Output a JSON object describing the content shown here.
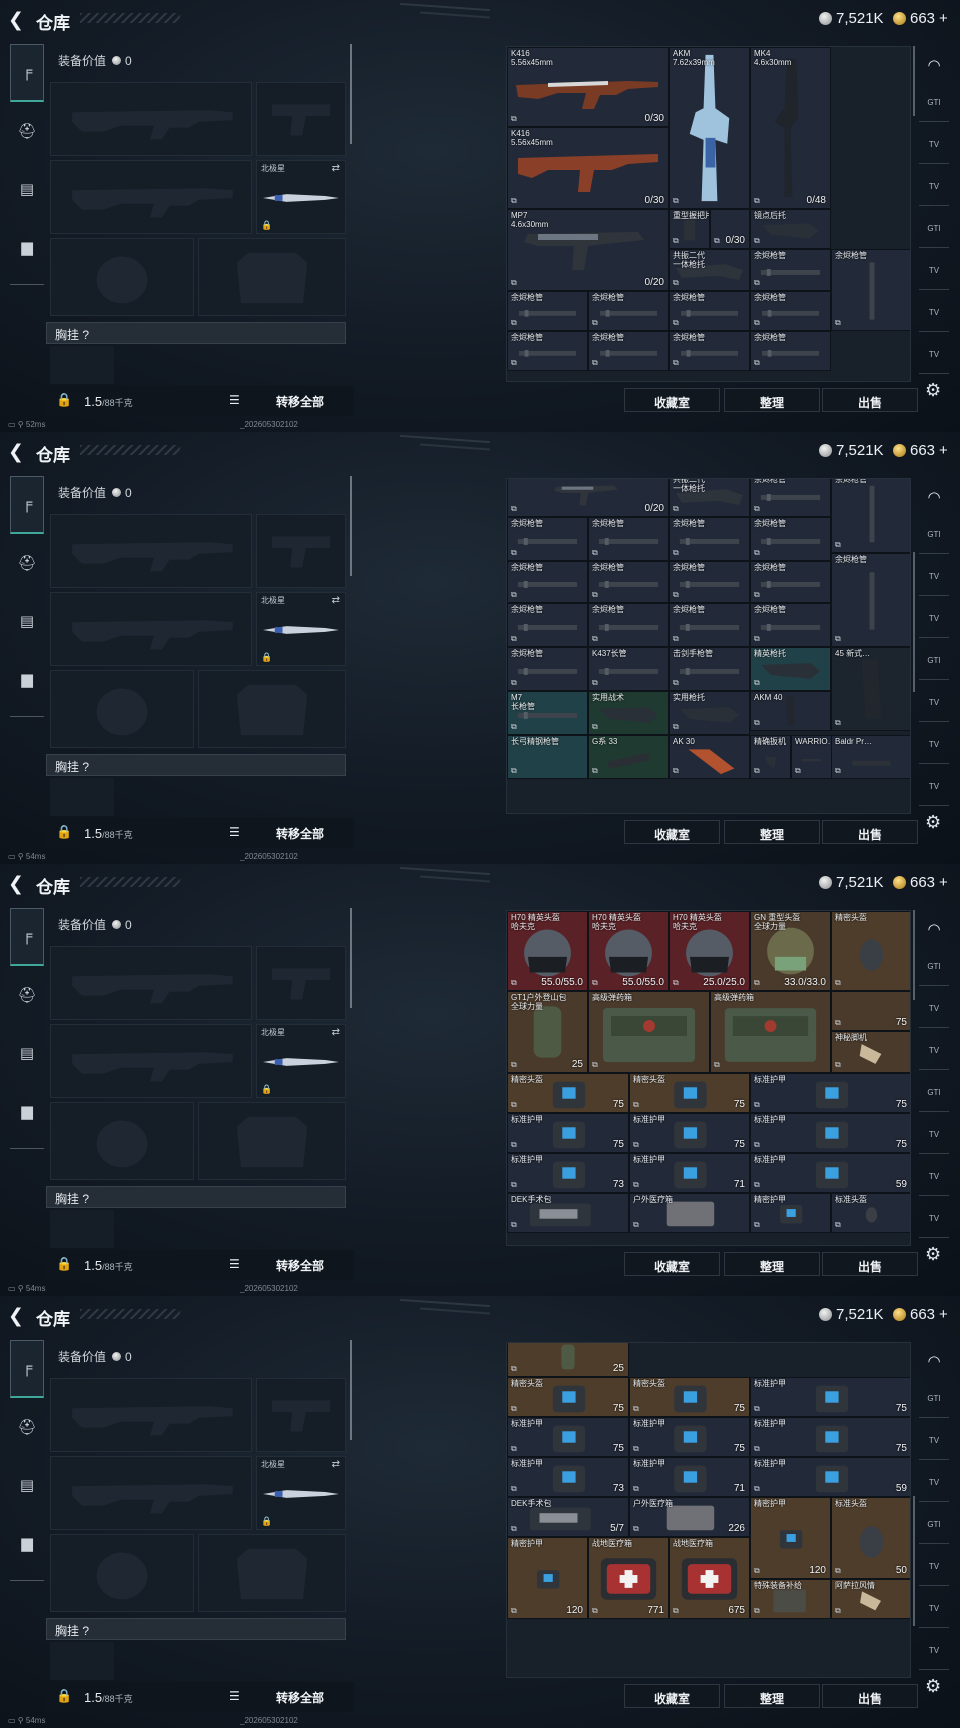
{
  "header": {
    "back_icon": "chevron-left-icon",
    "title": "仓库",
    "silver": "7,521K",
    "gold": "663",
    "gold_plus": "+"
  },
  "left_nav": {
    "icons": [
      "gun-icon",
      "helmet-icon",
      "vest-icon",
      "briefcase-icon"
    ]
  },
  "equipment": {
    "value_label": "装备价值",
    "value": "0",
    "melee_label": "北极星",
    "chest_label": "胸挂 ?",
    "weight": "1.5",
    "weight_max": "/88千克",
    "transfer_all": "转移全部"
  },
  "buttons": {
    "favorites": "收藏室",
    "sort": "整理",
    "sell": "出售"
  },
  "status": {
    "panel1": "52ms",
    "panel2": "54ms",
    "panel3": "54ms",
    "panel4": "54ms",
    "build": "_202605302102"
  },
  "rail": {
    "items": [
      "GTI",
      "TV",
      "TV",
      "GTI",
      "TV",
      "TV",
      "TV",
      "TV"
    ]
  },
  "colors": {
    "accent_teal": "#3fa89a",
    "item_red": "#5a2126",
    "item_brown": "#4a3a2b",
    "item_std": "#222938"
  },
  "panels": [
    {
      "cells": [
        {
          "name": "K416\n5.56x45mm",
          "value": "0/30"
        },
        {
          "name": "AKM\n7.62x39mm",
          "value": ""
        },
        {
          "name": "MK4\n4.6x30mm",
          "value": "0/48"
        },
        {
          "name": "K416\n5.56x45mm",
          "value": "0/30"
        },
        {
          "name": "MP7\n4.6x30mm",
          "value": "0/20"
        },
        {
          "name": "重型握把片",
          "value": ""
        },
        {
          "name": "",
          "value": "0/30"
        },
        {
          "name": "镜点后托",
          "value": ""
        },
        {
          "name": "共振二代\n一体枪托",
          "value": ""
        },
        {
          "name": "余烬枪管",
          "value": ""
        },
        {
          "name": "余烬枪管",
          "value": ""
        },
        {
          "name": "余烬枪管",
          "value": ""
        },
        {
          "name": "余烬枪管",
          "value": ""
        },
        {
          "name": "余烬枪管",
          "value": ""
        },
        {
          "name": "余烬枪管",
          "value": ""
        },
        {
          "name": "余烬枪管",
          "value": ""
        },
        {
          "name": "余烬枪管",
          "value": ""
        },
        {
          "name": "余烬枪管",
          "value": ""
        },
        {
          "name": "余烬枪管",
          "value": ""
        }
      ]
    },
    {
      "cells": [
        {
          "name": "",
          "value": "0/20"
        },
        {
          "name": "共振二代\n一体枪托",
          "value": ""
        },
        {
          "name": "余烬枪管",
          "value": ""
        },
        {
          "name": "余烬枪管",
          "value": ""
        },
        {
          "name": "余烬枪管",
          "value": ""
        },
        {
          "name": "余烬枪管",
          "value": ""
        },
        {
          "name": "余烬枪管",
          "value": ""
        },
        {
          "name": "余烬枪管",
          "value": ""
        },
        {
          "name": "余烬枪管",
          "value": ""
        },
        {
          "name": "余烬枪管",
          "value": ""
        },
        {
          "name": "余烬枪管",
          "value": ""
        },
        {
          "name": "余烬枪管",
          "value": ""
        },
        {
          "name": "余烬枪管",
          "value": ""
        },
        {
          "name": "余烬枪管",
          "value": ""
        },
        {
          "name": "余烬枪管",
          "value": ""
        },
        {
          "name": "余烬枪管",
          "value": ""
        },
        {
          "name": "余烬枪管",
          "value": ""
        },
        {
          "name": "余烬枪管",
          "value": ""
        },
        {
          "name": "K437长管",
          "value": ""
        },
        {
          "name": "击剑手枪管",
          "value": ""
        },
        {
          "name": "精英枪托",
          "value": ""
        },
        {
          "name": "45 新式…",
          "value": ""
        },
        {
          "name": "M7\n长枪管",
          "value": ""
        },
        {
          "name": "实用战术",
          "value": ""
        },
        {
          "name": "实用枪托",
          "value": ""
        },
        {
          "name": "AKM 40",
          "value": ""
        },
        {
          "name": "长弓精钢枪管",
          "value": ""
        },
        {
          "name": "G系 33",
          "value": ""
        },
        {
          "name": "AK 30",
          "value": ""
        },
        {
          "name": "精确扳机",
          "value": ""
        },
        {
          "name": "WARRIO…",
          "value": ""
        },
        {
          "name": "Baldr Pr…",
          "value": ""
        }
      ]
    },
    {
      "cells": [
        {
          "name": "H70 精英头盔\n哈夫克",
          "value": "55.0/55.0"
        },
        {
          "name": "H70 精英头盔\n哈夫克",
          "value": "55.0/55.0"
        },
        {
          "name": "H70 精英头盔\n哈夫克",
          "value": "25.0/25.0"
        },
        {
          "name": "GN 重型头盔\n全球力量",
          "value": "33.0/33.0"
        },
        {
          "name": "精密头盔",
          "value": ""
        },
        {
          "name": "GT1户外登山包\n全球力量",
          "value": "25"
        },
        {
          "name": "高级弹药箱",
          "value": ""
        },
        {
          "name": "高级弹药箱",
          "value": ""
        },
        {
          "name": "",
          "value": "75"
        },
        {
          "name": "神秘脚机",
          "value": ""
        },
        {
          "name": "精密头盔",
          "value": "75"
        },
        {
          "name": "精密头盔",
          "value": "75"
        },
        {
          "name": "标准护甲",
          "value": "75"
        },
        {
          "name": "标准护甲",
          "value": "75"
        },
        {
          "name": "标准护甲",
          "value": "75"
        },
        {
          "name": "标准护甲",
          "value": "75"
        },
        {
          "name": "标准护甲",
          "value": "73"
        },
        {
          "name": "标准护甲",
          "value": "71"
        },
        {
          "name": "标准护甲",
          "value": "59"
        },
        {
          "name": "DEK手术包",
          "value": ""
        },
        {
          "name": "户外医疗箱",
          "value": ""
        },
        {
          "name": "精密护甲",
          "value": ""
        },
        {
          "name": "标准头盔",
          "value": ""
        }
      ]
    },
    {
      "cells": [
        {
          "name": "",
          "value": "25"
        },
        {
          "name": "精密头盔",
          "value": "75"
        },
        {
          "name": "精密头盔",
          "value": "75"
        },
        {
          "name": "标准护甲",
          "value": "75"
        },
        {
          "name": "标准护甲",
          "value": "75"
        },
        {
          "name": "标准护甲",
          "value": "75"
        },
        {
          "name": "标准护甲",
          "value": "75"
        },
        {
          "name": "标准护甲",
          "value": "73"
        },
        {
          "name": "标准护甲",
          "value": "71"
        },
        {
          "name": "标准护甲",
          "value": "59"
        },
        {
          "name": "DEK手术包",
          "value": "5/7"
        },
        {
          "name": "户外医疗箱",
          "value": "226"
        },
        {
          "name": "精密护甲",
          "value": "120"
        },
        {
          "name": "标准头盔",
          "value": "50"
        },
        {
          "name": "精密护甲",
          "value": "120"
        },
        {
          "name": "战地医疗箱",
          "value": "771"
        },
        {
          "name": "战地医疗箱",
          "value": "675"
        },
        {
          "name": "特殊装备补给",
          "value": ""
        },
        {
          "name": "阿萨拉风情",
          "value": ""
        }
      ]
    }
  ]
}
